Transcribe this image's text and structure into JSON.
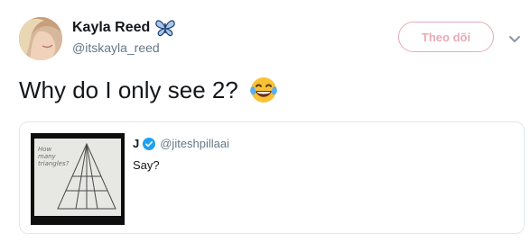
{
  "tweet": {
    "author": {
      "name": "Kayla Reed",
      "handle": "@itskayla_reed",
      "name_emoji": "butterfly-icon",
      "avatar": "profile-photo"
    },
    "follow_label": "Theo dõi",
    "menu_icon": "chevron-down-icon",
    "text": "Why do I only see 2?",
    "text_emoji": "face-with-tears-of-joy-icon"
  },
  "quoted": {
    "name": "J",
    "handle": "@jiteshpillaai",
    "verified": true,
    "text": "Say?",
    "image": {
      "description": "photo of hand-drawn triangle puzzle",
      "handwriting": "How many triangles?"
    }
  },
  "colors": {
    "follow_accent": "#e8aab6",
    "verified_blue": "#1da1f2",
    "muted_text": "#657786",
    "text": "#14171a",
    "card_border": "#e1e8ed"
  }
}
